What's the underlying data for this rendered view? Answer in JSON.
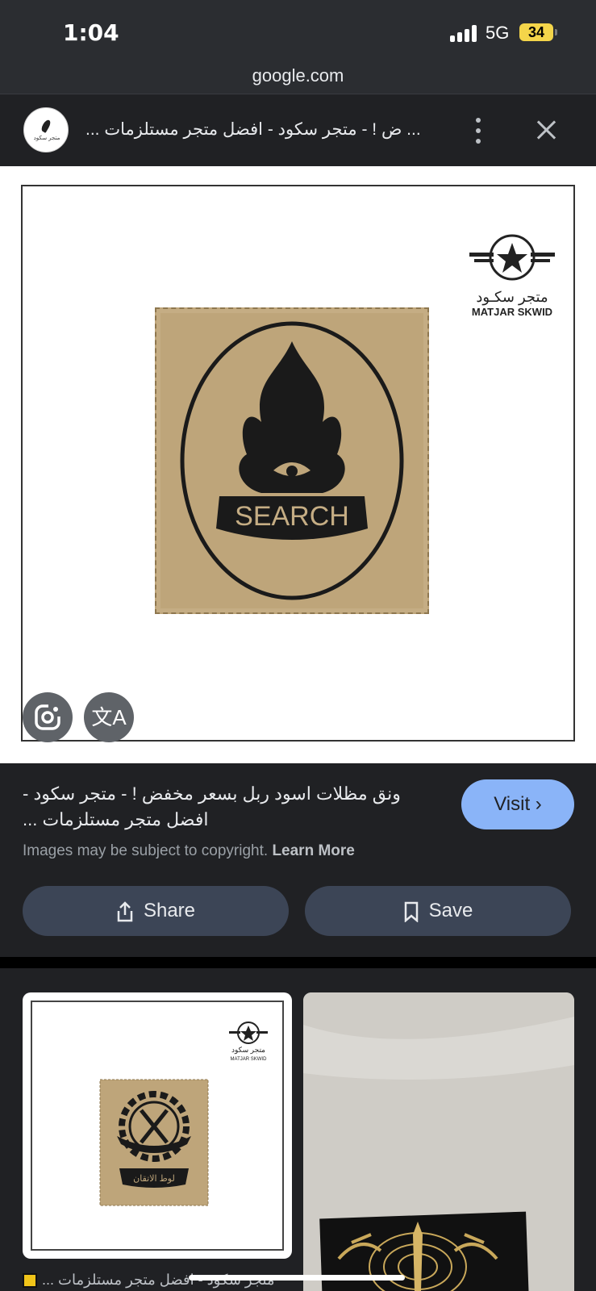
{
  "status_bar": {
    "time": "1:04",
    "network": "5G",
    "battery": "34"
  },
  "url_bar": {
    "domain": "google.com"
  },
  "header": {
    "title": "... ض ! - متجر سكود - افضل متجر مستلزمات ...",
    "more_icon": "more-vert-icon",
    "close_icon": "close-icon"
  },
  "image": {
    "brand_ar": "متجر سكـود",
    "brand_en": "MATJAR SKWID",
    "patch_text": "SEARCH"
  },
  "result": {
    "title": "ونق مظلات اسود ربل بسعر مخفض ! - متجر سكود - افضل متجر مستلزمات ...",
    "visit_label": "Visit",
    "copyright_text": "Images may be subject to copyright.",
    "learn_more": "Learn More",
    "share_label": "Share",
    "save_label": "Save"
  },
  "related": {
    "caption": "... متجر سكود - افضل متجر مستلزمات",
    "thumb1_brand_ar": "متجر سكود",
    "thumb1_brand_en": "MATJAR SKWID",
    "thumb1_patch_text": "لوط الاتقان"
  },
  "colors": {
    "accent": "#8ab4f8",
    "button_bg": "#3c4556",
    "patch": "#bea57a"
  }
}
